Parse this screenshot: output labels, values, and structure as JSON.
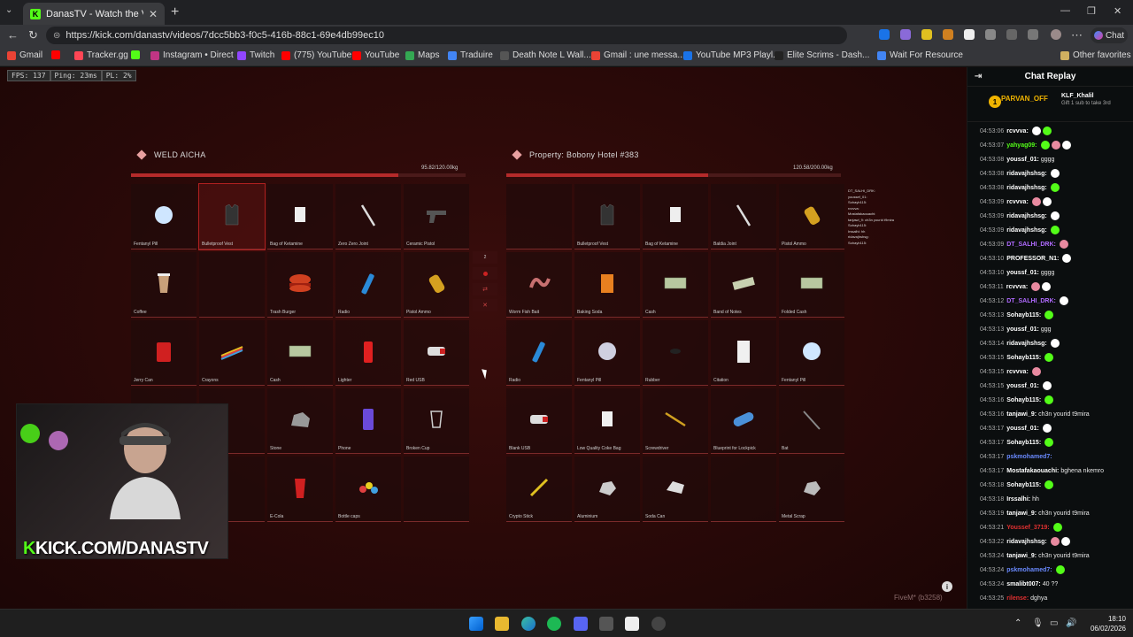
{
  "browser": {
    "tab_title": "DanasTV - Watch the VOD on Kick",
    "tab_favicon": "K",
    "url": "https://kick.com/danastv/videos/7dcc5bb3-f0c5-416b-88c1-69e4db99ec10",
    "chat_button": "Chat",
    "bookmarks": [
      {
        "label": "Gmail",
        "color": "#ea4335"
      },
      {
        "label": "",
        "color": "#ff0000"
      },
      {
        "label": "Tracker.gg",
        "color": "#ff4655"
      },
      {
        "label": "",
        "color": "#53fc18"
      },
      {
        "label": "Instagram • Direct",
        "color": "#c13584"
      },
      {
        "label": "Twitch",
        "color": "#9146ff"
      },
      {
        "label": "(775) YouTube",
        "color": "#ff0000"
      },
      {
        "label": "YouTube",
        "color": "#ff0000"
      },
      {
        "label": "Maps",
        "color": "#34a853"
      },
      {
        "label": "Traduire",
        "color": "#4285f4"
      },
      {
        "label": "Death Note L Wall...",
        "color": "#555555"
      },
      {
        "label": "Gmail : une messa...",
        "color": "#ea4335"
      },
      {
        "label": "YouTube MP3 Playl...",
        "color": "#1a73e8"
      },
      {
        "label": "Elite Scrims - Dash...",
        "color": "#222222"
      },
      {
        "label": "Wait For Resource",
        "color": "#4285f4"
      }
    ],
    "other_favorites": "Other favorites"
  },
  "hud": {
    "fps": "FPS: 137",
    "ping": "Ping: 23ms",
    "pl": "PL: 2%"
  },
  "left_panel": {
    "title": "WELD AICHA",
    "weight": "95.82/120.00kg",
    "weight_fraction": 0.7985,
    "items": [
      {
        "name": "Fentanyl Pill",
        "icon": "pill-icon",
        "color": "#cfe6ff"
      },
      {
        "name": "Bulletproof Vest",
        "icon": "vest-icon",
        "color": "#333333",
        "selected": true
      },
      {
        "name": "Bag of Ketamine",
        "icon": "bag-icon",
        "color": "#eeeeee"
      },
      {
        "name": "Zero Zero Joint",
        "icon": "joint-icon",
        "color": "#dddddd"
      },
      {
        "name": "Ceramic Pistol",
        "icon": "pistol-icon",
        "color": "#555555"
      },
      {
        "name": "Coffee",
        "icon": "coffee-icon",
        "color": "#c8a07a"
      },
      {
        "name": "",
        "icon": "",
        "color": ""
      },
      {
        "name": "Trash Burger",
        "icon": "burger-icon",
        "color": "#d04020"
      },
      {
        "name": "Radio",
        "icon": "radio-icon",
        "color": "#2a8ad8"
      },
      {
        "name": "Pistol Ammo",
        "icon": "ammo-icon",
        "color": "#d4a020"
      },
      {
        "name": "Jerry Can",
        "icon": "jerrycan-icon",
        "color": "#d02020"
      },
      {
        "name": "Crayons",
        "icon": "crayons-icon",
        "color": "#e8c020"
      },
      {
        "name": "Cash",
        "icon": "cash-icon",
        "color": "#b8c8a0"
      },
      {
        "name": "Lighter",
        "icon": "lighter-icon",
        "color": "#e02020"
      },
      {
        "name": "Red USB",
        "icon": "usb-icon",
        "color": "#dddddd"
      },
      {
        "name": "",
        "icon": "",
        "color": ""
      },
      {
        "name": "",
        "icon": "",
        "color": ""
      },
      {
        "name": "Stone",
        "icon": "stone-icon",
        "color": "#999999"
      },
      {
        "name": "Phone",
        "icon": "phone-icon",
        "color": "#6a4ad8"
      },
      {
        "name": "Broken Cup",
        "icon": "cup-icon",
        "color": "#cccccc"
      },
      {
        "name": "",
        "icon": "",
        "color": ""
      },
      {
        "name": "",
        "icon": "",
        "color": ""
      },
      {
        "name": "E-Cola",
        "icon": "cola-icon",
        "color": "#d02020"
      },
      {
        "name": "Bottle caps",
        "icon": "caps-icon",
        "color": "#e8d020"
      },
      {
        "name": "",
        "icon": "",
        "color": ""
      }
    ]
  },
  "right_panel": {
    "title": "Property: Bobony Hotel #383",
    "weight": "120.58/200.00kg",
    "weight_fraction": 0.6029,
    "items": [
      {
        "name": "",
        "icon": "",
        "color": ""
      },
      {
        "name": "Bulletproof Vest",
        "icon": "vest-icon",
        "color": "#333333"
      },
      {
        "name": "Bag of Ketamine",
        "icon": "bag-icon",
        "color": "#eeeeee"
      },
      {
        "name": "Baldia Joint",
        "icon": "joint-icon",
        "color": "#dddddd"
      },
      {
        "name": "Pistol Ammo",
        "icon": "ammo-icon",
        "color": "#d4a020"
      },
      {
        "name": "Worm Fish Bait",
        "icon": "worm-icon",
        "color": "#c87070"
      },
      {
        "name": "Baking Soda",
        "icon": "box-icon",
        "color": "#e88020"
      },
      {
        "name": "Cash",
        "icon": "cash-icon",
        "color": "#b8c8a0"
      },
      {
        "name": "Band of Notes",
        "icon": "notes-icon",
        "color": "#c8d0b0"
      },
      {
        "name": "Folded Cash",
        "icon": "cash-icon",
        "color": "#b8c8a0"
      },
      {
        "name": "Radio",
        "icon": "radio-icon",
        "color": "#2a8ad8"
      },
      {
        "name": "Fentanyl Pill",
        "icon": "pill-icon",
        "color": "#cfcfe0"
      },
      {
        "name": "Rubber",
        "icon": "rubber-icon",
        "color": "#222222"
      },
      {
        "name": "Citation",
        "icon": "paper-icon",
        "color": "#f0f0f0"
      },
      {
        "name": "Fentanyl Pill",
        "icon": "pill-icon",
        "color": "#cfe6ff"
      },
      {
        "name": "Blank USB",
        "icon": "usb-icon",
        "color": "#dddddd"
      },
      {
        "name": "Low Quality Coke Bag",
        "icon": "bag-icon",
        "color": "#f0f0f0"
      },
      {
        "name": "Screwdriver",
        "icon": "screwdriver-icon",
        "color": "#d0a020"
      },
      {
        "name": "Blueprint for Lockpick",
        "icon": "blueprint-icon",
        "color": "#4a90d8"
      },
      {
        "name": "Bat",
        "icon": "bat-icon",
        "color": "#888888"
      },
      {
        "name": "Crypto Stick",
        "icon": "stick-icon",
        "color": "#e0c020"
      },
      {
        "name": "Aluminium",
        "icon": "scrap-icon",
        "color": "#cccccc"
      },
      {
        "name": "Soda Can",
        "icon": "can-icon",
        "color": "#dddddd"
      },
      {
        "name": "",
        "icon": "",
        "color": ""
      },
      {
        "name": "Metal Scrap",
        "icon": "scrap-icon",
        "color": "#bbbbbb"
      }
    ]
  },
  "mid_controls": [
    "2",
    "",
    "",
    ""
  ],
  "feed": [
    "DT_SALHI_DRK: ",
    "youssef_01:",
    "Sohayb115:",
    "rcvvva:",
    "Mostafakaouachi:",
    "tanjawi_9: ch3n yourid t9mira",
    "Sohayb115:",
    "Irssalhi: hh",
    "ridavajhshsg:",
    "Sohayb115:"
  ],
  "brand": {
    "prefix": "K",
    "text": "KICK.COM/DANASTV"
  },
  "fivem": "FiveM* (b3258)",
  "chat": {
    "title": "Chat Replay",
    "pinned": {
      "badge": "1",
      "user": "PARVAN_OFF",
      "gifter": "KLF_Khalil",
      "text": "Gift 1 sub to take 3rd"
    },
    "messages": [
      {
        "t": "04:53:06",
        "u": "rcvvva:",
        "c": "#ffffff",
        "x": "",
        "e": 2
      },
      {
        "t": "04:53:07",
        "u": "yahyag09:",
        "c": "#53fc18",
        "x": "",
        "e": 3
      },
      {
        "t": "04:53:08",
        "u": "youssf_01:",
        "c": "#ffffff",
        "x": "gggg",
        "e": 0
      },
      {
        "t": "04:53:08",
        "u": "ridavajhshsg:",
        "c": "#ffffff",
        "x": "",
        "e": 1
      },
      {
        "t": "04:53:08",
        "u": "ridavajhshsg:",
        "c": "#ffffff",
        "x": "",
        "e": 1
      },
      {
        "t": "04:53:09",
        "u": "rcvvva:",
        "c": "#ffffff",
        "x": "",
        "e": 2
      },
      {
        "t": "04:53:09",
        "u": "ridavajhshsg:",
        "c": "#ffffff",
        "x": "",
        "e": 1
      },
      {
        "t": "04:53:09",
        "u": "ridavajhshsg:",
        "c": "#ffffff",
        "x": "",
        "e": 1
      },
      {
        "t": "04:53:09",
        "u": "DT_SALHI_DRK:",
        "c": "#b06aff",
        "x": "",
        "e": 1
      },
      {
        "t": "04:53:10",
        "u": "PROFESSOR_N1:",
        "c": "#ffffff",
        "x": "",
        "e": 1
      },
      {
        "t": "04:53:10",
        "u": "youssf_01:",
        "c": "#ffffff",
        "x": "gggg",
        "e": 0
      },
      {
        "t": "04:53:11",
        "u": "rcvvva:",
        "c": "#ffffff",
        "x": "",
        "e": 2
      },
      {
        "t": "04:53:12",
        "u": "DT_SALHI_DRK:",
        "c": "#b06aff",
        "x": "",
        "e": 1
      },
      {
        "t": "04:53:13",
        "u": "Sohayb115:",
        "c": "#ffffff",
        "x": "",
        "e": 1
      },
      {
        "t": "04:53:13",
        "u": "youssf_01:",
        "c": "#ffffff",
        "x": "ggg",
        "e": 0
      },
      {
        "t": "04:53:14",
        "u": "ridavajhshsg:",
        "c": "#ffffff",
        "x": "",
        "e": 1
      },
      {
        "t": "04:53:15",
        "u": "Sohayb115:",
        "c": "#ffffff",
        "x": "",
        "e": 1
      },
      {
        "t": "04:53:15",
        "u": "rcvvva:",
        "c": "#ffffff",
        "x": "",
        "e": 1
      },
      {
        "t": "04:53:15",
        "u": "youssf_01:",
        "c": "#ffffff",
        "x": "",
        "e": 1
      },
      {
        "t": "04:53:16",
        "u": "Sohayb115:",
        "c": "#ffffff",
        "x": "",
        "e": 1
      },
      {
        "t": "04:53:16",
        "u": "tanjawi_9:",
        "c": "#ffffff",
        "x": "ch3n yourid t9mira",
        "e": 0
      },
      {
        "t": "04:53:17",
        "u": "youssf_01:",
        "c": "#ffffff",
        "x": "",
        "e": 1
      },
      {
        "t": "04:53:17",
        "u": "Sohayb115:",
        "c": "#ffffff",
        "x": "",
        "e": 1
      },
      {
        "t": "04:53:17",
        "u": "pskmohamed7:",
        "c": "#6a8aff",
        "x": "",
        "e": 0
      },
      {
        "t": "04:53:17",
        "u": "Mostafakaouachi:",
        "c": "#ffffff",
        "x": "bghena nkemro",
        "e": 0
      },
      {
        "t": "04:53:18",
        "u": "Sohayb115:",
        "c": "#ffffff",
        "x": "",
        "e": 1
      },
      {
        "t": "04:53:18",
        "u": "Irssalhi:",
        "c": "#ffffff",
        "x": "hh",
        "e": 0
      },
      {
        "t": "04:53:19",
        "u": "tanjawi_9:",
        "c": "#ffffff",
        "x": "ch3n yourid t9mira",
        "e": 0
      },
      {
        "t": "04:53:21",
        "u": "Youssef_3719:",
        "c": "#e03030",
        "x": "",
        "e": 1
      },
      {
        "t": "04:53:22",
        "u": "ridavajhshsg:",
        "c": "#ffffff",
        "x": "",
        "e": 2
      },
      {
        "t": "04:53:24",
        "u": "tanjawi_9:",
        "c": "#ffffff",
        "x": "ch3n yourid t9mira",
        "e": 0
      },
      {
        "t": "04:53:24",
        "u": "pskmohamed7:",
        "c": "#6a8aff",
        "x": "",
        "e": 1
      },
      {
        "t": "04:53:24",
        "u": "smalibt007:",
        "c": "#ffffff",
        "x": "40 ??",
        "e": 0
      },
      {
        "t": "04:53:25",
        "u": "rilense:",
        "c": "#e03030",
        "x": "dghya",
        "e": 0
      }
    ]
  },
  "taskbar": {
    "time": "18:10",
    "date": "06/02/2026"
  }
}
